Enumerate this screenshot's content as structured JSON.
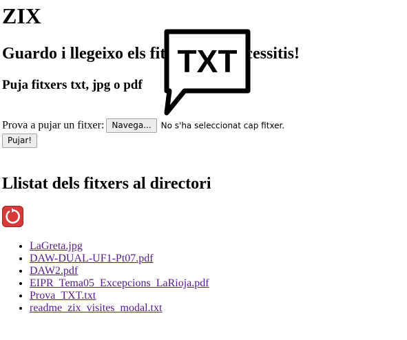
{
  "header": {
    "site_title": "ZIX",
    "subtitle": "Guardo i llegeixo els fitxers que necessitis!",
    "upload_heading": "Puja fitxers txt, jpg o pdf"
  },
  "upload_form": {
    "label": "Prova a pujar un fitxer:",
    "browse_label": "Navega...",
    "no_file_text": "No s'ha seleccionat cap fitxer.",
    "submit_label": "Pujar!"
  },
  "file_section": {
    "heading": "Llistat dels fitxers al directori",
    "refresh_icon": "refresh-icon",
    "files": [
      "LaGreta.jpg",
      "DAW-DUAL-UF1-Pt07.pdf",
      "DAW2.pdf",
      "EIPR_Tema05_Excepcions_LaRioja.pdf",
      "Prova_TXT.txt",
      "readme_zix_visites_modal.txt"
    ]
  },
  "logo": {
    "icon": "txt-speech-bubble-icon",
    "text": "TXT"
  },
  "colors": {
    "link_visited": "#551a8b",
    "refresh_bg": "#d63a3a",
    "logo_ink": "#000000"
  }
}
